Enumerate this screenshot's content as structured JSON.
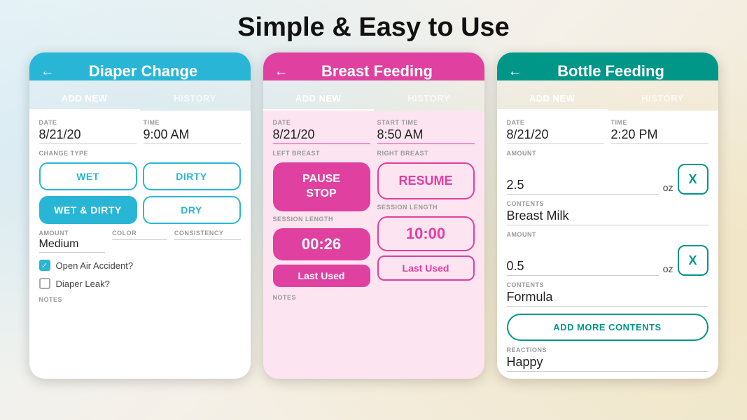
{
  "page": {
    "title": "Simple & Easy to Use"
  },
  "diaper": {
    "header_title": "Diaper Change",
    "tab_add_new": "ADD NEW",
    "tab_history": "HISTORY",
    "date_label": "DATE",
    "date_value": "8/21/20",
    "time_label": "TIME",
    "time_value": "9:00 AM",
    "change_type_label": "CHANGE TYPE",
    "btn_wet": "WET",
    "btn_dirty": "DIRTY",
    "btn_wet_dirty": "WET & DIRTY",
    "btn_dry": "DRY",
    "amount_label": "AMOUNT",
    "amount_value": "Medium",
    "color_label": "COLOR",
    "consistency_label": "CONSISTENCY",
    "check1_label": "Open Air Accident?",
    "check1_checked": true,
    "check2_label": "Diaper Leak?",
    "check2_checked": false,
    "notes_label": "NOTES"
  },
  "breast": {
    "header_title": "Breast Feeding",
    "tab_add_new": "ADD NEW",
    "tab_history": "HISTORY",
    "date_label": "DATE",
    "date_value": "8/21/20",
    "start_time_label": "START TIME",
    "start_time_value": "8:50 AM",
    "left_breast_label": "LEFT BREAST",
    "right_breast_label": "RIGHT BREAST",
    "btn_pause": "PAUSE",
    "btn_stop": "STOP",
    "btn_resume": "RESUME",
    "session_length_label1": "SESSION LENGTH",
    "session_length_label2": "SESSION LENGTH",
    "session_value1": "00:26",
    "session_value2": "10:00",
    "last_used1": "Last Used",
    "last_used2": "Last Used",
    "notes_label": "NOTES"
  },
  "bottle": {
    "header_title": "Bottle Feeding",
    "tab_add_new": "ADD NEW",
    "tab_history": "HISTORY",
    "date_label": "DATE",
    "date_value": "8/21/20",
    "time_label": "TIME",
    "time_value": "2:20 PM",
    "amount1_label": "AMOUNT",
    "amount1_value": "2.5",
    "oz1": "oz",
    "btn_x1": "X",
    "contents1_label": "CONTENTS",
    "contents1_value": "Breast Milk",
    "amount2_label": "AMOUNT",
    "amount2_value": "0.5",
    "oz2": "oz",
    "btn_x2": "X",
    "contents2_label": "CONTENTS",
    "contents2_value": "Formula",
    "add_more_label": "ADD MORE CONTENTS",
    "reactions_label": "REACTIONS",
    "reactions_value": "Happy"
  }
}
